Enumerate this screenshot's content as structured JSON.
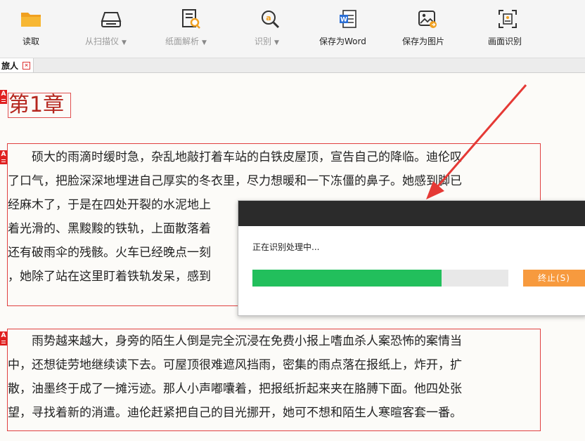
{
  "toolbar": {
    "read": "读取",
    "scan": "从扫描仪",
    "parse": "纸面解析",
    "recognize": "识别",
    "save_word": "保存为Word",
    "save_image": "保存为图片",
    "screen_recognize": "画面识别"
  },
  "tab": {
    "label": "旅人"
  },
  "document": {
    "chapter_title": "第1章",
    "paragraphs": [
      {
        "lines": [
          "　　硕大的雨滴时缓时急，杂乱地敲打着车站的白铁皮屋顶，宣告自己的降临。迪伦叹",
          "了口气，把脸深深地埋进自己厚实的冬衣里，尽力想暖和一下冻僵的鼻子。她感到脚已",
          "经麻木了，于是在四处开裂的水泥地上",
          "着光滑的、黑黢黢的铁轨，上面散落着",
          "还有破雨伞的残骸。火车已经晚点一刻",
          "，她除了站在这里盯着铁轨发呆，感到"
        ]
      },
      {
        "lines": [
          "　　雨势越来越大，身旁的陌生人倒是完全沉浸在免费小报上嗜血杀人案恐怖的案情当",
          "中，还想徒劳地继续读下去。可屋顶很难遮风挡雨，密集的雨点落在报纸上，炸开，扩",
          "散，油墨终于成了一摊污迹。那人小声嘟囔着，把报纸折起来夹在胳膊下面。他四处张",
          "望，寻找着新的消遣。迪伦赶紧把自己的目光挪开，她可不想和陌生人寒暄客套一番。"
        ]
      }
    ]
  },
  "dialog": {
    "message": "正在识别处理中...",
    "progress": 0.74,
    "stop_label": "终止(S)"
  },
  "colors": {
    "accent_red": "#e02020",
    "progress_green": "#22bf5c",
    "stop_orange": "#f79a3e",
    "arrow_red": "#e53935"
  }
}
